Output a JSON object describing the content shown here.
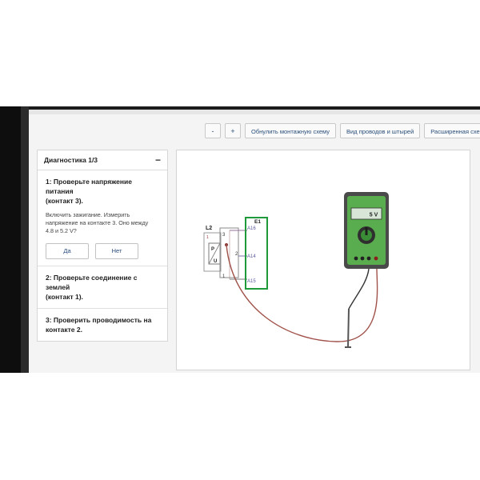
{
  "toolbar": {
    "minus_label": "-",
    "plus_label": "+",
    "refresh_label": "Обнулить монтажную схему",
    "wires_label": "Вид проводов и штырей",
    "extended_label": "Расширенная схема"
  },
  "panel": {
    "title": "Диагностика 1/3",
    "collapse_symbol": "−",
    "steps": [
      {
        "title_line1": "1: Проверьте напряжение питания",
        "title_line2": "(контакт 3).",
        "desc_line1": "Включить зажигание. Измерить",
        "desc_line2": "напряжение на контакте 3. Оно между",
        "desc_line3": "4.8 и 5.2 V?",
        "yes_label": "Да",
        "no_label": "Нет"
      },
      {
        "title_line1": "2: Проверьте соединение с землей",
        "title_line2": "(контакт 1)."
      },
      {
        "title_line1": "3: Проверить проводимость на",
        "title_line2": "контакте 2."
      }
    ]
  },
  "diagram": {
    "component_l2": "L2",
    "component_e1": "E1",
    "pins": [
      "3",
      "2",
      "1"
    ],
    "pin_sub": "1",
    "connector_pins": [
      "A16",
      "A14",
      "A15"
    ],
    "sensor_p": "P",
    "sensor_u": "U",
    "multimeter_reading": "5 V",
    "colors": {
      "connector_green": "#1e9a3a",
      "wire_brown": "#a0524a",
      "meter_green": "#4fa64a"
    }
  }
}
